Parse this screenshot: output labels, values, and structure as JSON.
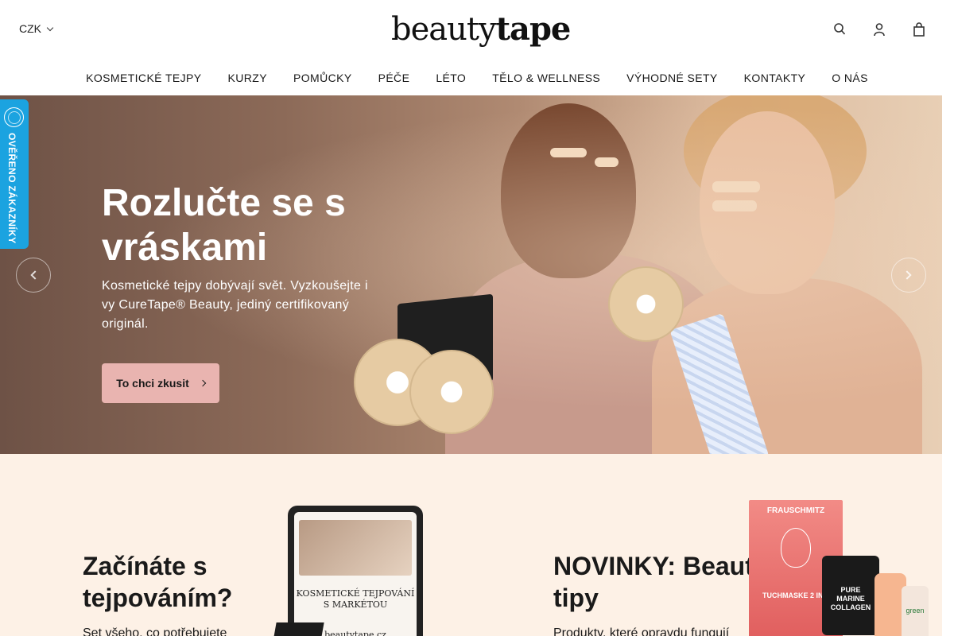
{
  "header": {
    "currency": "CZK",
    "logo_light": "beauty",
    "logo_bold": "tape",
    "icons": [
      "search-icon",
      "user-icon",
      "cart-icon"
    ]
  },
  "nav": {
    "items": [
      "KOSMETICKÉ TEJPY",
      "KURZY",
      "POMŮCKY",
      "PÉČE",
      "LÉTO",
      "TĚLO & WELLNESS",
      "VÝHODNÉ SETY",
      "KONTAKTY",
      "O NÁS"
    ]
  },
  "badge": {
    "label": "OVĚŘENO ZÁKAZNÍKY"
  },
  "hero": {
    "title": "Rozlučte se s vráskami",
    "subtitle": "Kosmetické tejpy dobývají svět. Vyzkoušejte i vy CureTape® Beauty, jediný certifikovaný originál.",
    "button_label": "To chci zkusit",
    "colors": {
      "button": "#e9b4b0",
      "text": "#ffffff"
    }
  },
  "cards": [
    {
      "title": "Začínáte s tejpováním?",
      "text": "Set všeho, co potřebujete",
      "image_text": "KOSMETICKÉ TEJPOVÁNÍ S MARKÉTOU",
      "image_brand": "beautytape.cz"
    },
    {
      "title": "NOVINKY: Beauty tipy",
      "text": "Produkty, které opravdu fungují",
      "image_mask_brand": "FRAUSCHMITZ",
      "image_mask_label": "TUCHMASKE 2 IN 1",
      "image_jar_label": "PURE MARINE COLLAGEN",
      "image_bottle_label": "green"
    }
  ],
  "colors": {
    "badge": "#1ba3e0",
    "lower_bg": "#fdf1e6"
  }
}
